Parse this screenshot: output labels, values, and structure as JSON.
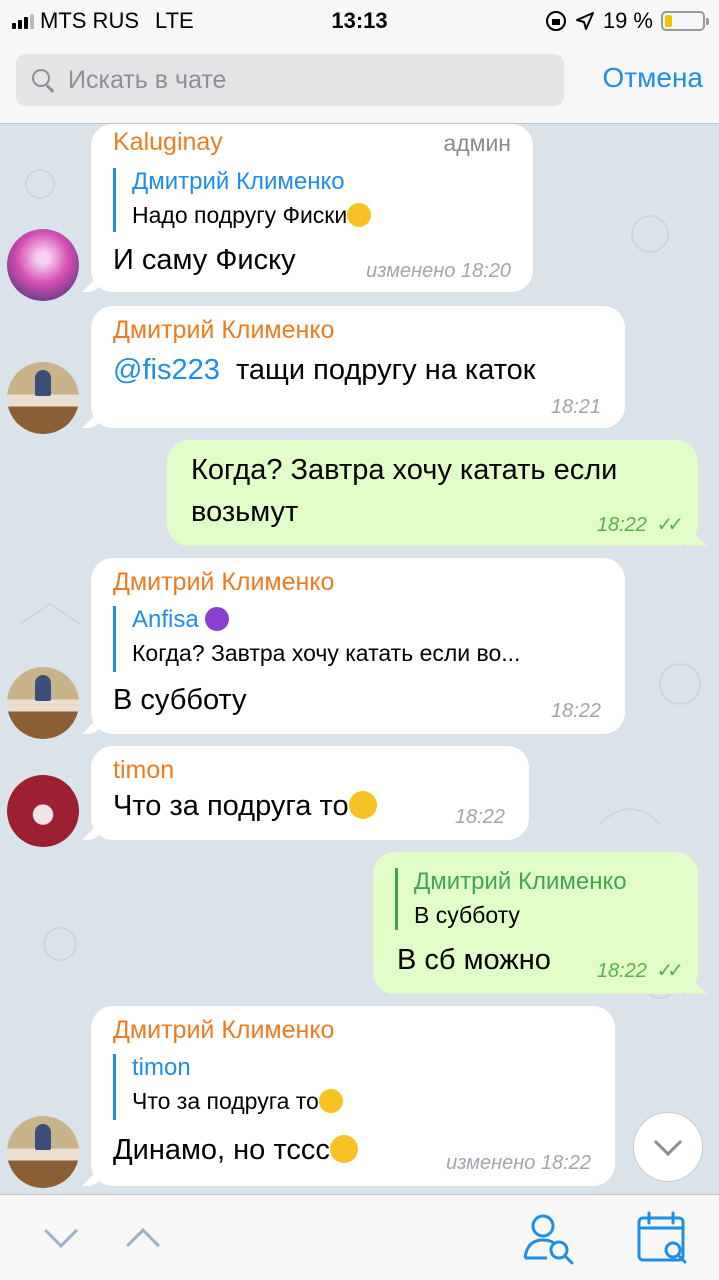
{
  "status_bar": {
    "carrier": "MTS RUS",
    "network": "LTE",
    "time": "13:13",
    "battery": "19 %",
    "battery_level": 0.19
  },
  "search": {
    "placeholder": "Искать в чате",
    "value": "",
    "cancel_label": "Отмена"
  },
  "messages": [
    {
      "sender": "Kaluginay",
      "role": "админ",
      "reply_name": "Дмитрий Клименко",
      "reply_text": "Надо подругу Фиски",
      "text": "И саму Фиску",
      "time": "изменено 18:20"
    },
    {
      "sender": "Дмитрий Клименко",
      "mention": "@fis223",
      "text": "тащи подругу на каток",
      "time": "18:21"
    },
    {
      "text_line1": "Когда? Завтра хочу катать если",
      "text_line2": "возьмут",
      "time": "18:22"
    },
    {
      "sender": "Дмитрий Клименко",
      "reply_name": "Anfisa",
      "reply_text": "Когда? Завтра хочу катать если во...",
      "text": "В субботу",
      "time": "18:22"
    },
    {
      "sender": "timon",
      "text": "Что за подруга то",
      "time": "18:22"
    },
    {
      "reply_name": "Дмитрий Клименко",
      "reply_text": "В субботу",
      "text": "В сб можно",
      "time": "18:22"
    },
    {
      "sender": "Дмитрий Клименко",
      "reply_name": "timon",
      "reply_text": "Что за подруга то",
      "text": "Динамо, но тссс",
      "time": "изменено 18:22"
    }
  ],
  "icons": {
    "tears_of_joy": "tears-of-joy-emoji",
    "grin": "grinning-emoji",
    "devil": "smiling-devil-emoji",
    "read_ticks": "double-check-icon"
  },
  "colors": {
    "accent": "#1e8ee6",
    "sender": "#ee7c1e",
    "outgoing": "#e2fec8",
    "chat_bg": "#dbe3ea"
  }
}
